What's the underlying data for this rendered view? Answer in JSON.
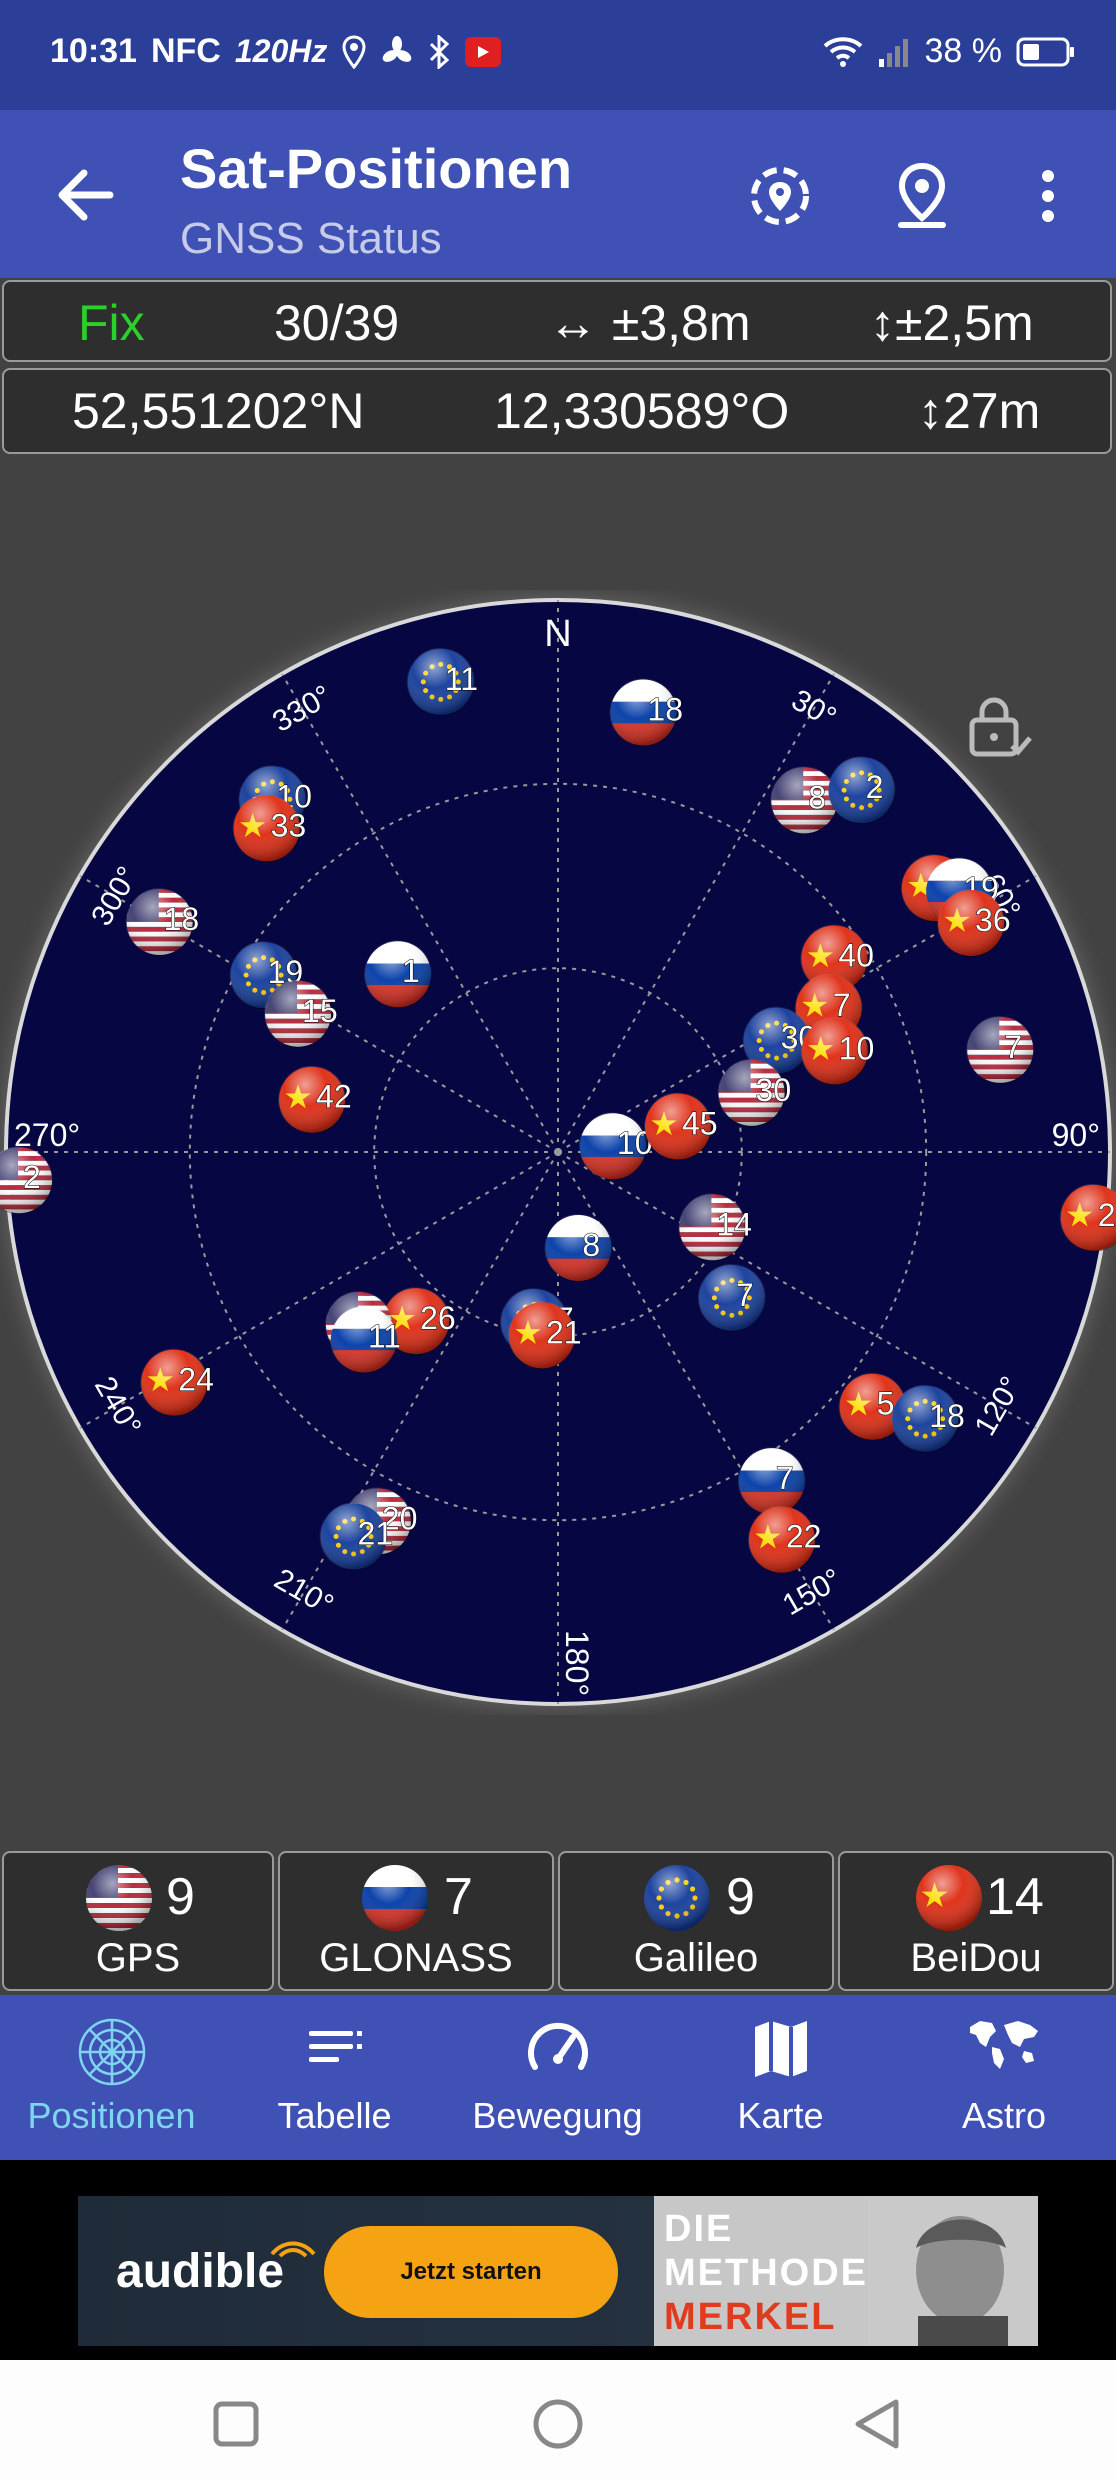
{
  "status_bar": {
    "time": "10:31",
    "nfc": "NFC",
    "refresh": "120Hz",
    "battery": "38 %"
  },
  "app_bar": {
    "title": "Sat-Positionen",
    "subtitle": "GNSS Status",
    "icons": [
      "back-arrow-icon",
      "location-target-icon",
      "map-pin-icon",
      "more-vert-icon"
    ]
  },
  "fix_info": {
    "status": "Fix",
    "sats_used": "30/39",
    "h_accuracy": "↔ ±3,8m",
    "v_accuracy": "↕±2,5m"
  },
  "position": {
    "latitude": "52,551202°N",
    "longitude": "12,330589°O",
    "altitude": "↕27m"
  },
  "sky_plot": {
    "north_label": "N",
    "east_label": "90°",
    "west_label": "270°",
    "south_label": "180°",
    "bearing_labels": [
      "30°",
      "60°",
      "120°",
      "150°",
      "210°",
      "240°",
      "300°",
      "330°"
    ],
    "lock_icon": "lock-icon",
    "colors": {
      "sky": "#060642",
      "gps": "#b22234",
      "glonass": "#0039a6",
      "galileo": "#003399",
      "beidou": "#de2910"
    },
    "satellites": [
      {
        "type": "galileo",
        "id": "11",
        "az": 346,
        "el": 11
      },
      {
        "type": "glonass",
        "id": "18",
        "az": 11,
        "el": 17
      },
      {
        "type": "gps",
        "id": "8",
        "az": 35,
        "el": 20
      },
      {
        "type": "galileo",
        "id": "2",
        "az": 40,
        "el": 13
      },
      {
        "type": "galileo",
        "id": "10",
        "az": 321,
        "el": 16
      },
      {
        "type": "beidou",
        "id": "33",
        "az": 318,
        "el": 19
      },
      {
        "type": "gps",
        "id": "18",
        "az": 300,
        "el": 15
      },
      {
        "type": "beidou",
        "id": "30",
        "az": 55,
        "el": 15
      },
      {
        "type": "glonass",
        "id": "19",
        "az": 57,
        "el": 12
      },
      {
        "type": "beidou",
        "id": "36",
        "az": 61,
        "el": 13
      },
      {
        "type": "beidou",
        "id": "40",
        "az": 55,
        "el": 35
      },
      {
        "type": "beidou",
        "id": "7",
        "az": 62,
        "el": 40
      },
      {
        "type": "gps",
        "id": "7",
        "az": 77,
        "el": 16
      },
      {
        "type": "galileo",
        "id": "19",
        "az": 301,
        "el": 34
      },
      {
        "type": "gps",
        "id": "15",
        "az": 298,
        "el": 42
      },
      {
        "type": "glonass",
        "id": "1",
        "az": 318,
        "el": 51
      },
      {
        "type": "galileo",
        "id": "30",
        "az": 63,
        "el": 50
      },
      {
        "type": "beidou",
        "id": "10",
        "az": 70,
        "el": 42
      },
      {
        "type": "gps",
        "id": "30",
        "az": 73,
        "el": 57
      },
      {
        "type": "beidou",
        "id": "42",
        "az": 282,
        "el": 49
      },
      {
        "type": "glonass",
        "id": "10",
        "az": 84,
        "el": 81
      },
      {
        "type": "beidou",
        "id": "45",
        "az": 78,
        "el": 70
      },
      {
        "type": "gps",
        "id": "2",
        "az": 267,
        "el": 2
      },
      {
        "type": "gps",
        "id": "14",
        "az": 116,
        "el": 62
      },
      {
        "type": "beidou",
        "id": "2",
        "az": 97,
        "el": 2
      },
      {
        "type": "glonass",
        "id": "8",
        "az": 168,
        "el": 74
      },
      {
        "type": "galileo",
        "id": "7",
        "az": 130,
        "el": 53
      },
      {
        "type": "beidou",
        "id": "26",
        "az": 220,
        "el": 54
      },
      {
        "type": "gps",
        "id": "5",
        "az": 229,
        "el": 47
      },
      {
        "type": "glonass",
        "id": "11",
        "az": 226,
        "el": 46
      },
      {
        "type": "galileo",
        "id": "27",
        "az": 188,
        "el": 62
      },
      {
        "type": "beidou",
        "id": "21",
        "az": 185,
        "el": 60
      },
      {
        "type": "beidou",
        "id": "24",
        "az": 239,
        "el": 17
      },
      {
        "type": "beidou",
        "id": "5",
        "az": 129,
        "el": 24
      },
      {
        "type": "galileo",
        "id": "18",
        "az": 126,
        "el": 16
      },
      {
        "type": "glonass",
        "id": "7",
        "az": 147,
        "el": 26
      },
      {
        "type": "beidou",
        "id": "22",
        "az": 150,
        "el": 17
      },
      {
        "type": "gps",
        "id": "20",
        "az": 206,
        "el": 23
      },
      {
        "type": "galileo",
        "id": "21",
        "az": 208,
        "el": 19
      }
    ]
  },
  "constellation_counts": [
    {
      "name": "GPS",
      "count": "9",
      "flag": "us-flag-icon"
    },
    {
      "name": "GLONASS",
      "count": "7",
      "flag": "ru-flag-icon"
    },
    {
      "name": "Galileo",
      "count": "9",
      "flag": "eu-flag-icon"
    },
    {
      "name": "BeiDou",
      "count": "14",
      "flag": "cn-flag-icon"
    }
  ],
  "bottom_nav": [
    {
      "label": "Positionen",
      "icon": "radar-icon",
      "active": true
    },
    {
      "label": "Tabelle",
      "icon": "list-icon",
      "active": false
    },
    {
      "label": "Bewegung",
      "icon": "speedometer-icon",
      "active": false
    },
    {
      "label": "Karte",
      "icon": "map-icon",
      "active": false
    },
    {
      "label": "Astro",
      "icon": "world-map-icon",
      "active": false
    }
  ],
  "ad": {
    "brand": "audible",
    "button": "Jetzt starten",
    "headline": [
      "DIE",
      "METHODE",
      "MERKEL"
    ]
  },
  "system_nav": [
    "recents-icon",
    "home-icon",
    "back-icon"
  ]
}
